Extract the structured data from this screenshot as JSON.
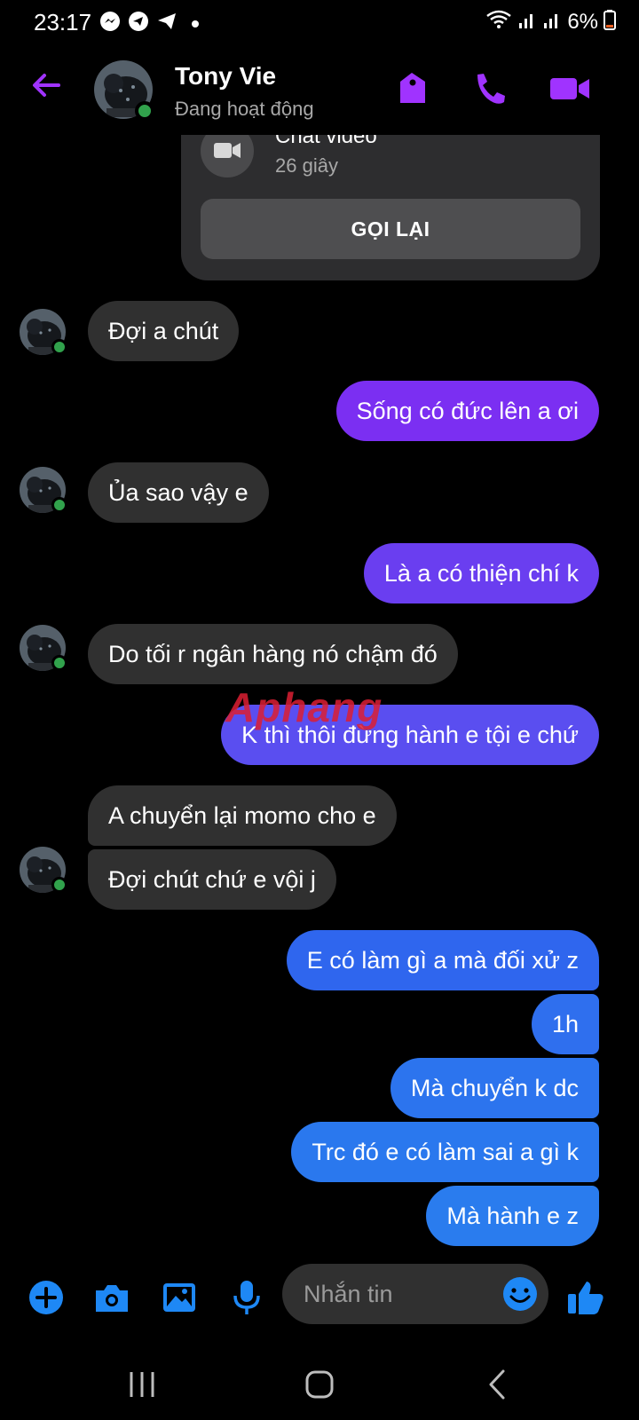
{
  "status_bar": {
    "time": "23:17",
    "battery": "6%",
    "icons": [
      "messenger-icon",
      "telegram-icon",
      "telegram-send-icon",
      "wifi-icon",
      "signal-icon",
      "signal-icon",
      "battery-icon"
    ]
  },
  "header": {
    "contact_name": "Tony Vie",
    "contact_status": "Đang hoạt động",
    "accent_color": "#a033ff"
  },
  "call_card": {
    "title": "Chat video",
    "duration": "26 giây",
    "button_label": "GỌI LẠI"
  },
  "messages": [
    {
      "side": "in",
      "text": "Đợi a chút"
    },
    {
      "side": "out",
      "text": "Sống có đức lên a ơi",
      "color": "#7b2ff2"
    },
    {
      "side": "in",
      "text": "Ủa sao vậy e"
    },
    {
      "side": "out",
      "text": "Là a có thiện chí k",
      "color": "#6a3ef0"
    },
    {
      "side": "in",
      "text": "Do tối r ngân hàng nó chậm đó"
    },
    {
      "side": "out",
      "text": "K thì thôi đừng hành e tội e chứ",
      "color": "#5a4ef0"
    },
    {
      "side": "in",
      "text": "A chuyển lại momo cho e"
    },
    {
      "side": "in",
      "text": "Đợi chút chứ e vội j"
    },
    {
      "side": "out",
      "text": "E có làm gì a mà đối xử z",
      "color": "#2f66ee"
    },
    {
      "side": "out",
      "text": "1h",
      "color": "#2f6fee"
    },
    {
      "side": "out",
      "text": "Mà chuyển k dc",
      "color": "#2c74ee"
    },
    {
      "side": "out",
      "text": "Trc đó e có làm sai a gì k",
      "color": "#2a78ee"
    },
    {
      "side": "out",
      "text": "Mà hành e z",
      "color": "#2a7cee"
    }
  ],
  "watermark": "Aphang",
  "composer": {
    "placeholder": "Nhắn tin",
    "accent_color": "#1e88f5"
  }
}
